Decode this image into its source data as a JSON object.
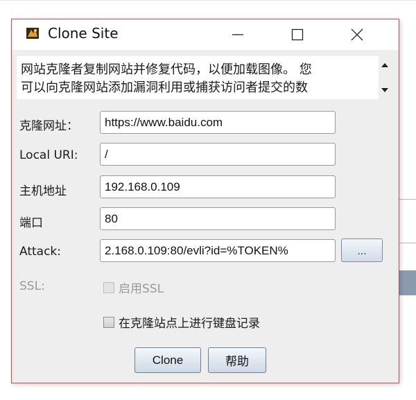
{
  "window": {
    "title": "Clone Site",
    "app_icon": "app-icon",
    "controls": [
      "minimize-icon",
      "maximize-icon",
      "close-icon"
    ]
  },
  "description": {
    "line1": "网站克隆者复制网站并修复代码，以便加载图像。 您",
    "line2": "可以向克隆网站添加漏洞利用或捕获访问者提交的数"
  },
  "form": {
    "clone_url": {
      "label": "克隆网址：",
      "value": "https://www.baidu.com"
    },
    "local_uri": {
      "label": "Local URI:",
      "value": "/"
    },
    "host": {
      "label": "主机地址",
      "value": "192.168.0.109"
    },
    "port": {
      "label": "端口",
      "value": "80"
    },
    "attack": {
      "label": "Attack:",
      "value": "2.168.0.109:80/evli?id=%TOKEN%",
      "browse_label": "..."
    },
    "ssl": {
      "label": "SSL:",
      "checkbox_label": "启用SSL",
      "checked": false,
      "enabled": false
    },
    "keylog": {
      "checkbox_label": "在克隆站点上进行键盘记录",
      "checked": false
    }
  },
  "buttons": {
    "clone": "Clone",
    "help": "帮助"
  }
}
